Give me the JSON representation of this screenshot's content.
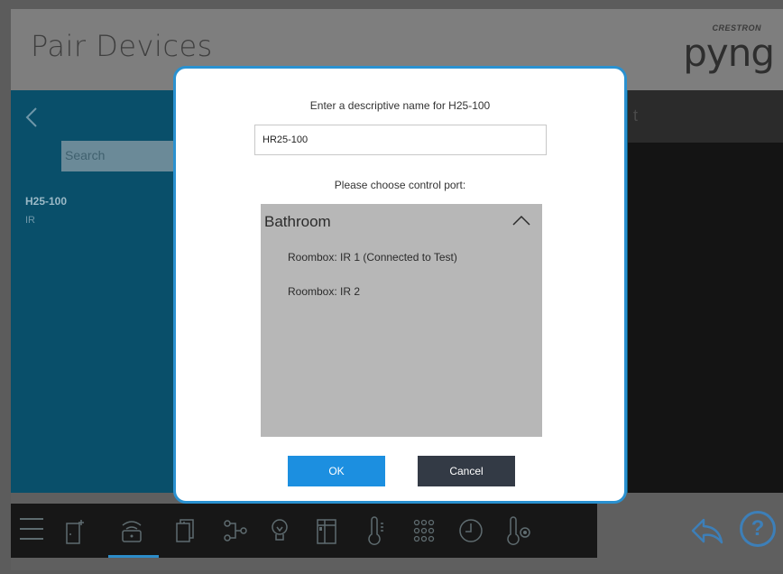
{
  "header": {
    "title": "Pair Devices",
    "logo_small": "CRESTRON",
    "logo_main": "pyng"
  },
  "left_panel": {
    "search_placeholder": "Search",
    "device_name": "H25-100",
    "device_type": "IR"
  },
  "right_panel": {
    "header_text": "t"
  },
  "modal": {
    "prompt": "Enter a descriptive name for H25-100",
    "name_value": "HR25-100",
    "port_prompt": "Please choose control port:",
    "room": "Bathroom",
    "ports": [
      "Roombox: IR 1 (Connected to Test)",
      "Roombox: IR 2"
    ],
    "ok_label": "OK",
    "cancel_label": "Cancel"
  },
  "footer": {
    "help_label": "?"
  },
  "colors": {
    "accent": "#1c8fe0",
    "left_panel": "#094f6a",
    "modal_border": "#2a91d0",
    "cancel": "#333a45"
  }
}
